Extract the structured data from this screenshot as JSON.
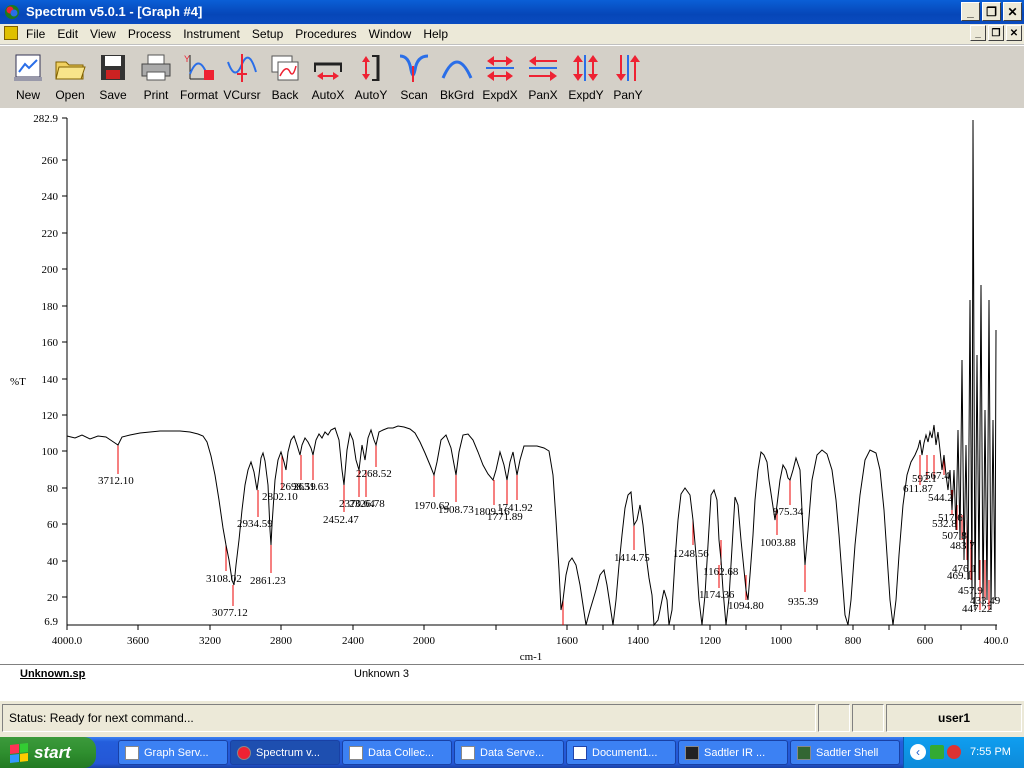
{
  "window": {
    "title": "Spectrum v5.0.1 - [Graph #4]"
  },
  "menu": [
    "File",
    "Edit",
    "View",
    "Process",
    "Instrument",
    "Setup",
    "Procedures",
    "Window",
    "Help"
  ],
  "toolbar": [
    "New",
    "Open",
    "Save",
    "Print",
    "Format",
    "VCursr",
    "Back",
    "AutoX",
    "AutoY",
    "Scan",
    "BkGrd",
    "ExpdX",
    "PanX",
    "ExpdY",
    "PanY"
  ],
  "graph": {
    "ylabel": "%T",
    "xlabel": "cm-1",
    "y_min": "6.9",
    "y_max": "282.9",
    "xticks": [
      "4000.0",
      "3600",
      "3200",
      "2800",
      "2400",
      "2000",
      "1600",
      "1200",
      "800",
      "400.0",
      "1400",
      "1000",
      "600"
    ],
    "yticks": [
      "260",
      "240",
      "220",
      "200",
      "180",
      "160",
      "140",
      "120",
      "100",
      "80",
      "60",
      "40",
      "20"
    ],
    "peaks": [
      "3712.10",
      "3108.02",
      "3077.12",
      "2934.59",
      "2861.23",
      "2802.10",
      "2698.59",
      "2631.63",
      "2452.47",
      "2370.64",
      "2326.78",
      "2268.52",
      "1970.62",
      "1908.73",
      "1809.16",
      "1771.89",
      "1741.92",
      "1414.75",
      "1248.56",
      "1162.68",
      "1174.36",
      "1094.80",
      "1003.88",
      "975.34",
      "935.39",
      "611.87",
      "592.1",
      "567.4",
      "544.2",
      "532.8",
      "517.6",
      "507.8",
      "483.7",
      "476.1",
      "469.1",
      "457.9",
      "447.22",
      "433.49"
    ]
  },
  "file": {
    "name": "Unknown.sp",
    "sample": "Unknown 3"
  },
  "status": {
    "text": "Status: Ready for next command...",
    "user": "user1"
  },
  "taskbar": {
    "start": "start",
    "items": [
      "Graph Serv...",
      "Spectrum v...",
      "Data Collec...",
      "Data Serve...",
      "Document1...",
      "Sadtler IR ...",
      "Sadtler Shell"
    ],
    "clock": "7:55 PM"
  }
}
